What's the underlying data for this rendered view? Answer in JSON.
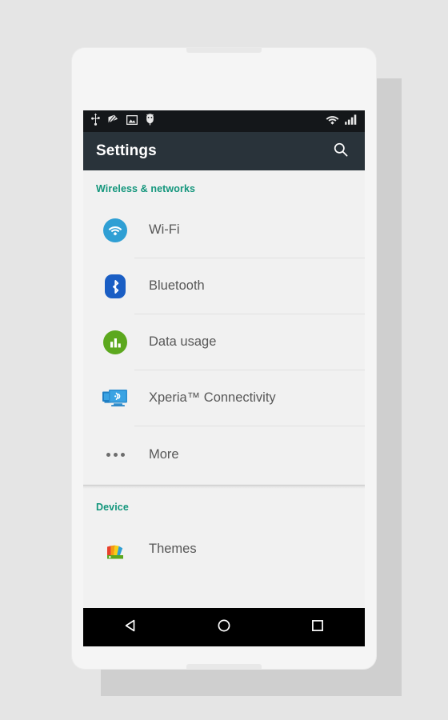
{
  "device": {
    "frame_color": "#f5f5f5",
    "background_color": "#e5e5e5",
    "shadow_color": "#cfcfcf"
  },
  "status_bar": {
    "background": "#14171a",
    "left_icons": [
      {
        "name": "usb-icon",
        "label": "USB"
      },
      {
        "name": "screenshot-icon",
        "label": "Screenshot"
      },
      {
        "name": "image-icon",
        "label": "Image"
      },
      {
        "name": "usb-debug-icon",
        "label": "USB debugging"
      }
    ],
    "right_icons": [
      {
        "name": "wifi-status-icon",
        "label": "Wi-Fi"
      },
      {
        "name": "cellular-signal-icon",
        "label": "Signal"
      }
    ]
  },
  "app_bar": {
    "title": "Settings",
    "background": "#29333a",
    "search_label": "Search"
  },
  "accent_color": "#13967c",
  "sections": [
    {
      "header": "Wireless & networks",
      "items": [
        {
          "label": "Wi-Fi",
          "icon": "wifi-icon",
          "color": "#2f9fd4"
        },
        {
          "label": "Bluetooth",
          "icon": "bluetooth-icon",
          "color": "#1a5ec4"
        },
        {
          "label": "Data usage",
          "icon": "data-usage-icon",
          "color": "#5ca81e"
        },
        {
          "label": "Xperia™ Connectivity",
          "icon": "xperia-connectivity-icon",
          "color": "#3aa3e3"
        },
        {
          "label": "More",
          "icon": "more-icon",
          "color": "#6d6d6d"
        }
      ]
    },
    {
      "header": "Device",
      "items": [
        {
          "label": "Themes",
          "icon": "themes-icon",
          "color": "#5ca81e"
        }
      ]
    }
  ],
  "nav_bar": {
    "background": "#000000",
    "buttons": [
      {
        "name": "back-button",
        "label": "Back"
      },
      {
        "name": "home-button",
        "label": "Home"
      },
      {
        "name": "recents-button",
        "label": "Recents"
      }
    ]
  }
}
